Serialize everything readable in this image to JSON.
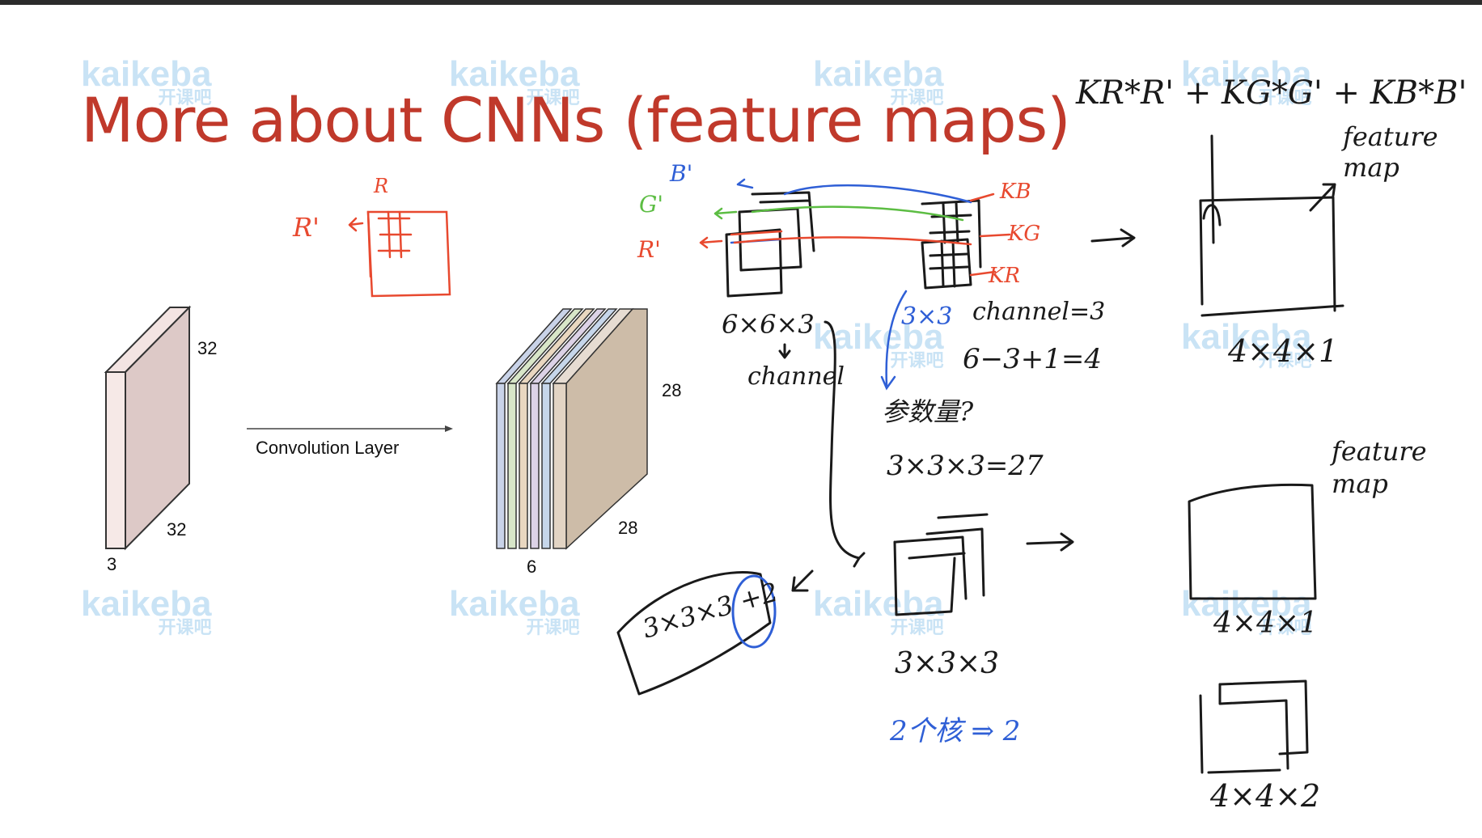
{
  "slide": {
    "title": "More about CNNs (feature maps)",
    "watermark": {
      "brand": "kaikeba",
      "sub": "开课吧"
    }
  },
  "diagram": {
    "input_volume": {
      "height_label": "32",
      "width_label": "32",
      "depth_label": "3"
    },
    "arrow_label": "Convolution Layer",
    "output_volume": {
      "height_label": "28",
      "width_label": "28",
      "depth_label": "6"
    }
  },
  "annotations": {
    "formula": "KR*R' + KG*G' + KB*B'",
    "feature_map_top": "feature map",
    "feature_map_mid": "feature map",
    "size_top": "4×4×1",
    "size_mid": "4×4×1",
    "size_bottom": "4×4×2",
    "input_size": "6×6×3",
    "channel": "channel",
    "kernel": "3×3",
    "channel_eq": "channel=3",
    "calc": "6−3+1=4",
    "params_q": "参数量?",
    "params": "3×3×3=27",
    "params_box": "3×3×3 +2",
    "kernel_size": "3×3×3",
    "two_kernels": "2个核 ⇒ 2",
    "r_left": "R'",
    "r_top": "R",
    "g_prime": "G'",
    "b_prime": "B'",
    "r_prime2": "R'",
    "kb": "KB",
    "kg": "KG",
    "kr": "KR"
  },
  "colors": {
    "title": "#c0392b",
    "ink": "#1a1a1a",
    "red_ink": "#e8492f",
    "blue_ink": "#2f5fd6",
    "green_ink": "#5cbd43",
    "watermark": "#c9e3f5"
  }
}
